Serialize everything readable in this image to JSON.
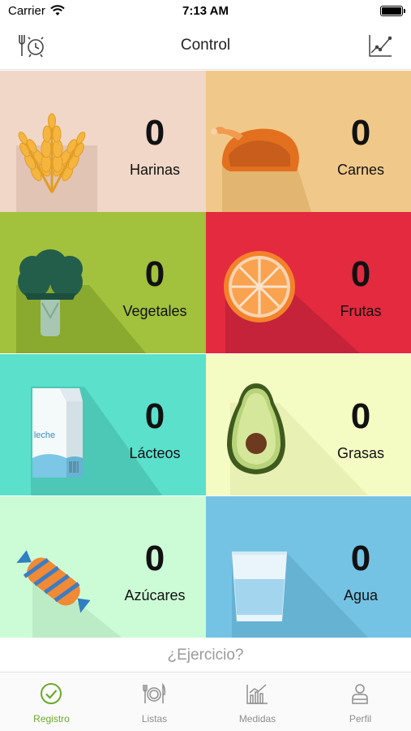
{
  "status_bar": {
    "carrier": "Carrier",
    "time": "7:13 AM"
  },
  "nav": {
    "title": "Control",
    "left_icon": "meal-clock-icon",
    "right_icon": "line-chart-icon"
  },
  "tiles": [
    {
      "label": "Harinas",
      "count": "0",
      "color": "#f1d7c8",
      "icon": "wheat-icon"
    },
    {
      "label": "Carnes",
      "count": "0",
      "color": "#f0c98a",
      "icon": "chicken-icon"
    },
    {
      "label": "Vegetales",
      "count": "0",
      "color": "#a2c13c",
      "icon": "broccoli-icon"
    },
    {
      "label": "Frutas",
      "count": "0",
      "color": "#e32a3f",
      "icon": "orange-icon"
    },
    {
      "label": "Lácteos",
      "count": "0",
      "color": "#5be0cc",
      "icon": "milk-carton-icon",
      "icon_text": "leche"
    },
    {
      "label": "Grasas",
      "count": "0",
      "color": "#f4fcc4",
      "icon": "avocado-icon"
    },
    {
      "label": "Azúcares",
      "count": "0",
      "color": "#ccfcd6",
      "icon": "candy-icon"
    },
    {
      "label": "Agua",
      "count": "0",
      "color": "#74c3e4",
      "icon": "water-glass-icon"
    }
  ],
  "exercise": {
    "label": "¿Ejercicio?"
  },
  "tabs": [
    {
      "label": "Registro",
      "icon": "check-circle-icon",
      "active": true
    },
    {
      "label": "Listas",
      "icon": "plate-cutlery-icon",
      "active": false
    },
    {
      "label": "Medidas",
      "icon": "bar-chart-icon",
      "active": false
    },
    {
      "label": "Perfil",
      "icon": "person-icon",
      "active": false
    }
  ],
  "colors": {
    "accent": "#6aaa2c",
    "inactive": "#8e8e8e"
  }
}
